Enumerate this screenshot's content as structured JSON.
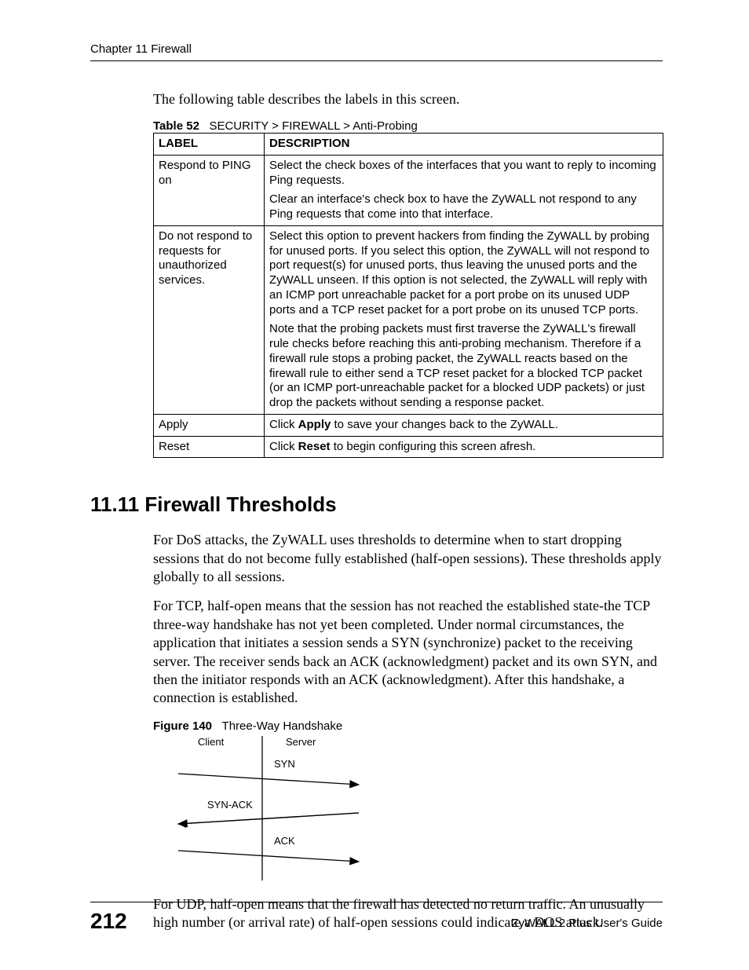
{
  "header": {
    "chapter": "Chapter 11 Firewall"
  },
  "intro_text": "The following table describes the labels in this screen.",
  "table": {
    "caption_prefix": "Table 52",
    "caption_text": "SECURITY > FIREWALL > Anti-Probing",
    "headers": {
      "label": "LABEL",
      "desc": "DESCRIPTION"
    },
    "rows": [
      {
        "label": "Respond to PING on",
        "desc_p1": "Select the check boxes of the interfaces that you want to reply to incoming Ping requests.",
        "desc_p2": "Clear an interface's check box to have the ZyWALL not respond to any Ping requests that come into that interface."
      },
      {
        "label": "Do not respond to requests for unauthorized services.",
        "desc_p1": "Select this option to prevent hackers from finding the ZyWALL by probing for unused ports. If you select this option, the ZyWALL will not respond to port request(s) for unused ports, thus leaving the unused ports and the ZyWALL unseen. If this option is not selected, the ZyWALL will reply with an ICMP port unreachable packet for a port probe on its unused UDP ports and a TCP reset packet for a port probe on its unused TCP ports.",
        "desc_p2": "Note that the probing packets must first traverse the ZyWALL's firewall rule checks before reaching this anti-probing mechanism. Therefore if a firewall rule stops a probing packet, the ZyWALL reacts based on the firewall rule to either send a TCP reset packet for a blocked TCP packet (or an ICMP port-unreachable packet for a blocked UDP packets) or just drop the packets without sending a response packet."
      },
      {
        "label": "Apply",
        "desc_pre": "Click ",
        "desc_bold": "Apply",
        "desc_post": " to save your changes back to the ZyWALL."
      },
      {
        "label": "Reset",
        "desc_pre": "Click ",
        "desc_bold": "Reset",
        "desc_post": " to begin configuring this screen afresh."
      }
    ]
  },
  "section": {
    "number_title": "11.11  Firewall Thresholds",
    "para1": "For DoS attacks, the ZyWALL uses thresholds to determine when to start dropping sessions that do not become fully established (half-open sessions). These thresholds apply globally to all sessions.",
    "para2": "For TCP, half-open means that the session has not reached the established state-the TCP three-way handshake has not yet been completed. Under normal circumstances, the application that initiates a session sends a SYN (synchronize) packet to the receiving server. The receiver sends back an ACK (acknowledgment) packet and its own SYN, and then the initiator responds with an ACK (acknowledgment). After this handshake, a connection is established.",
    "para3": "For UDP, half-open means that the firewall has detected no return traffic. An unusually high number (or arrival rate) of half-open sessions could indicate a DOS attack."
  },
  "figure": {
    "caption_prefix": "Figure 140",
    "caption_text": "Three-Way Handshake",
    "labels": {
      "client": "Client",
      "server": "Server",
      "syn": "SYN",
      "synack": "SYN-ACK",
      "ack": "ACK"
    }
  },
  "footer": {
    "page": "212",
    "guide": "ZyWALL 2 Plus User's Guide"
  }
}
